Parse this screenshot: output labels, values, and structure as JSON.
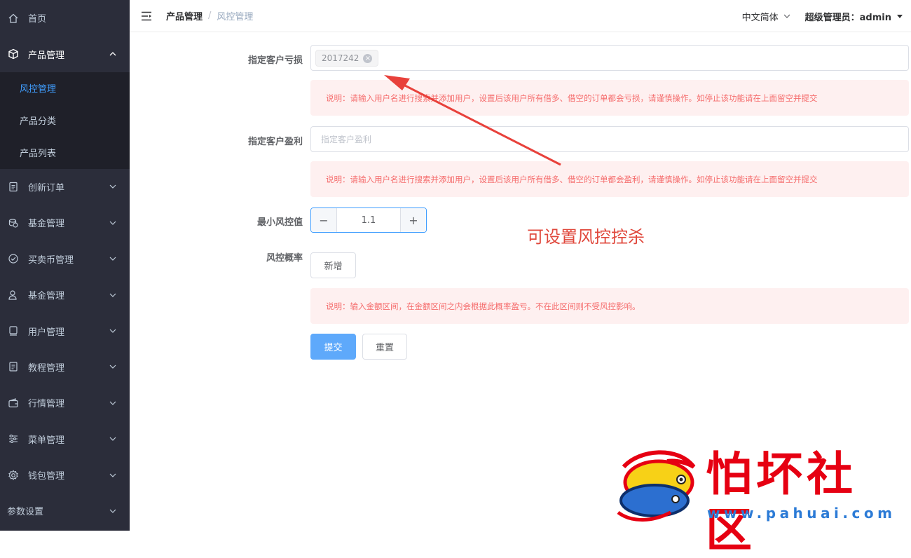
{
  "sidebar": {
    "items": [
      {
        "label": "首页",
        "icon": "home-icon"
      },
      {
        "label": "产品管理",
        "icon": "cube-icon"
      },
      {
        "label": "创新订单",
        "icon": "clipboard-icon"
      },
      {
        "label": "基金管理",
        "icon": "coins-icon"
      },
      {
        "label": "买卖币管理",
        "icon": "check-circle-icon"
      },
      {
        "label": "基金管理",
        "icon": "user-icon"
      },
      {
        "label": "用户管理",
        "icon": "user-card-icon"
      },
      {
        "label": "教程管理",
        "icon": "document-icon"
      },
      {
        "label": "行情管理",
        "icon": "wallet-icon"
      },
      {
        "label": "菜单管理",
        "icon": "sliders-icon"
      },
      {
        "label": "钱包管理",
        "icon": "gear-icon"
      },
      {
        "label": "参数设置",
        "icon": ""
      }
    ],
    "sub_items": [
      "风控管理",
      "产品分类",
      "产品列表"
    ],
    "active_sub": "风控管理"
  },
  "header": {
    "breadcrumb": [
      "产品管理",
      "风控管理"
    ],
    "separator": "/",
    "language": "中文简体",
    "user": "超级管理员：admin"
  },
  "form": {
    "loss_label": "指定客户亏损",
    "loss_tag": "2017242",
    "loss_note": "说明：请输入用户名进行搜索并添加用户，设置后该用户所有借多、借空的订单都会亏损，请谨慎操作。如停止该功能请在上面留空并提交",
    "profit_label": "指定客户盈利",
    "profit_placeholder": "指定客户盈利",
    "profit_note": "说明：请输入用户名进行搜索并添加用户，设置后该用户所有借多、借空的订单都会盈利，请谨慎操作。如停止该功能请在上面留空并提交",
    "min_label": "最小风控值",
    "min_value": "1.1",
    "prob_label": "风控概率",
    "add_button": "新增",
    "prob_note": "说明：输入金额区间，在金额区间之内会根据此概率盈亏。不在此区间则不受风控影响。",
    "submit_button": "提交",
    "reset_button": "重置"
  },
  "annotation": "可设置风控控杀",
  "watermark": {
    "title": "怕坏社区",
    "url": "www.pahuai.com"
  },
  "colors": {
    "sidebar_bg": "#2b2d3a",
    "active": "#409eff",
    "alert_bg": "#fef0f0",
    "alert_text": "#f56c6c",
    "annotation": "#e0483c"
  }
}
